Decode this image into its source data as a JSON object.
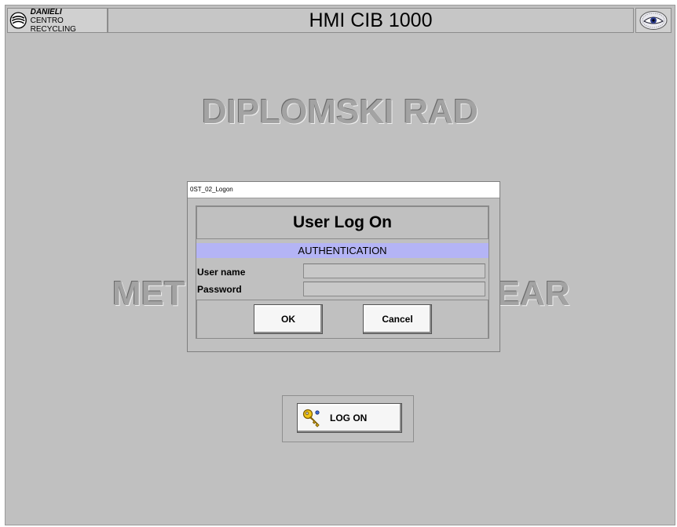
{
  "header": {
    "brand_name": "DANIELI",
    "brand_sub": "CENTRO RECYCLING",
    "title": "HMI CIB 1000"
  },
  "background": {
    "heading_line1": "DIPLOMSKI RAD",
    "heading_line2_left": "MET",
    "heading_line2_right": "EAR"
  },
  "logon": {
    "button_label": "LOG ON",
    "icon": "key-icon"
  },
  "dialog": {
    "window_title": "0ST_02_Logon",
    "heading": "User Log On",
    "section": "AUTHENTICATION",
    "username_label": "User name",
    "username_value": "",
    "password_label": "Password",
    "password_value": "",
    "ok_label": "OK",
    "cancel_label": "Cancel"
  },
  "colors": {
    "background": "#c0c0c0",
    "auth_bar": "#b4b4f5",
    "button_face": "#f6f6f6"
  }
}
